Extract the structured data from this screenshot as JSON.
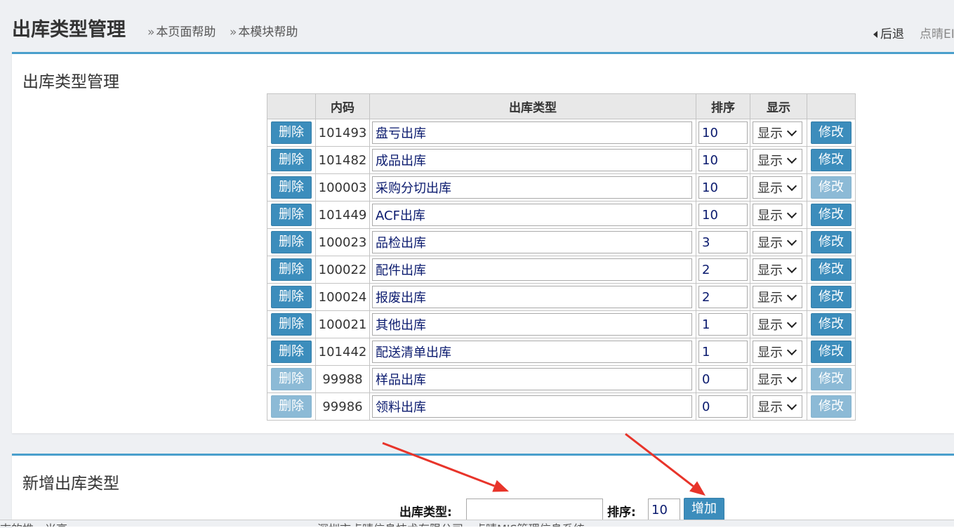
{
  "header": {
    "title": "出库类型管理",
    "help_page": "本页面帮助",
    "help_module": "本模块帮助",
    "back": "后退",
    "right_text": "点晴EI"
  },
  "list_panel": {
    "title": "出库类型管理",
    "columns": [
      "",
      "内码",
      "出库类型",
      "排序",
      "显示",
      ""
    ],
    "delete_label": "删除",
    "modify_label": "修改",
    "rows": [
      {
        "code": "101493",
        "name": "盘亏出库",
        "sort": "10",
        "show": "显示",
        "delete_enabled": true,
        "modify_enabled": true
      },
      {
        "code": "101482",
        "name": "成品出库",
        "sort": "10",
        "show": "显示",
        "delete_enabled": true,
        "modify_enabled": true
      },
      {
        "code": "100003",
        "name": "采购分切出库",
        "sort": "10",
        "show": "显示",
        "delete_enabled": true,
        "modify_enabled": false
      },
      {
        "code": "101449",
        "name": "ACF出库",
        "sort": "10",
        "show": "显示",
        "delete_enabled": true,
        "modify_enabled": true
      },
      {
        "code": "100023",
        "name": "品检出库",
        "sort": "3",
        "show": "显示",
        "delete_enabled": true,
        "modify_enabled": true
      },
      {
        "code": "100022",
        "name": "配件出库",
        "sort": "2",
        "show": "显示",
        "delete_enabled": true,
        "modify_enabled": true
      },
      {
        "code": "100024",
        "name": "报废出库",
        "sort": "2",
        "show": "显示",
        "delete_enabled": true,
        "modify_enabled": true
      },
      {
        "code": "100021",
        "name": "其他出库",
        "sort": "1",
        "show": "显示",
        "delete_enabled": true,
        "modify_enabled": true
      },
      {
        "code": "101442",
        "name": "配送清单出库",
        "sort": "1",
        "show": "显示",
        "delete_enabled": true,
        "modify_enabled": true
      },
      {
        "code": "99988",
        "name": "样品出库",
        "sort": "0",
        "show": "显示",
        "delete_enabled": false,
        "modify_enabled": false
      },
      {
        "code": "99986",
        "name": "领料出库",
        "sort": "0",
        "show": "显示",
        "delete_enabled": false,
        "modify_enabled": false
      }
    ]
  },
  "add_panel": {
    "title": "新增出库类型",
    "name_label": "出库类型:",
    "name_value": "",
    "sort_label": "排序:",
    "sort_value": "10",
    "add_label": "增加"
  },
  "footer": {
    "left": "志的推，米高",
    "center": "深圳市点晴信息技术有限公司 - 点晴MIS管理信息系统"
  },
  "colors": {
    "accent": "#3c8dbc",
    "disabled_button": "#8cbad6",
    "panel_border": "#4a9fcc",
    "annotation_arrow": "#e8342a"
  }
}
